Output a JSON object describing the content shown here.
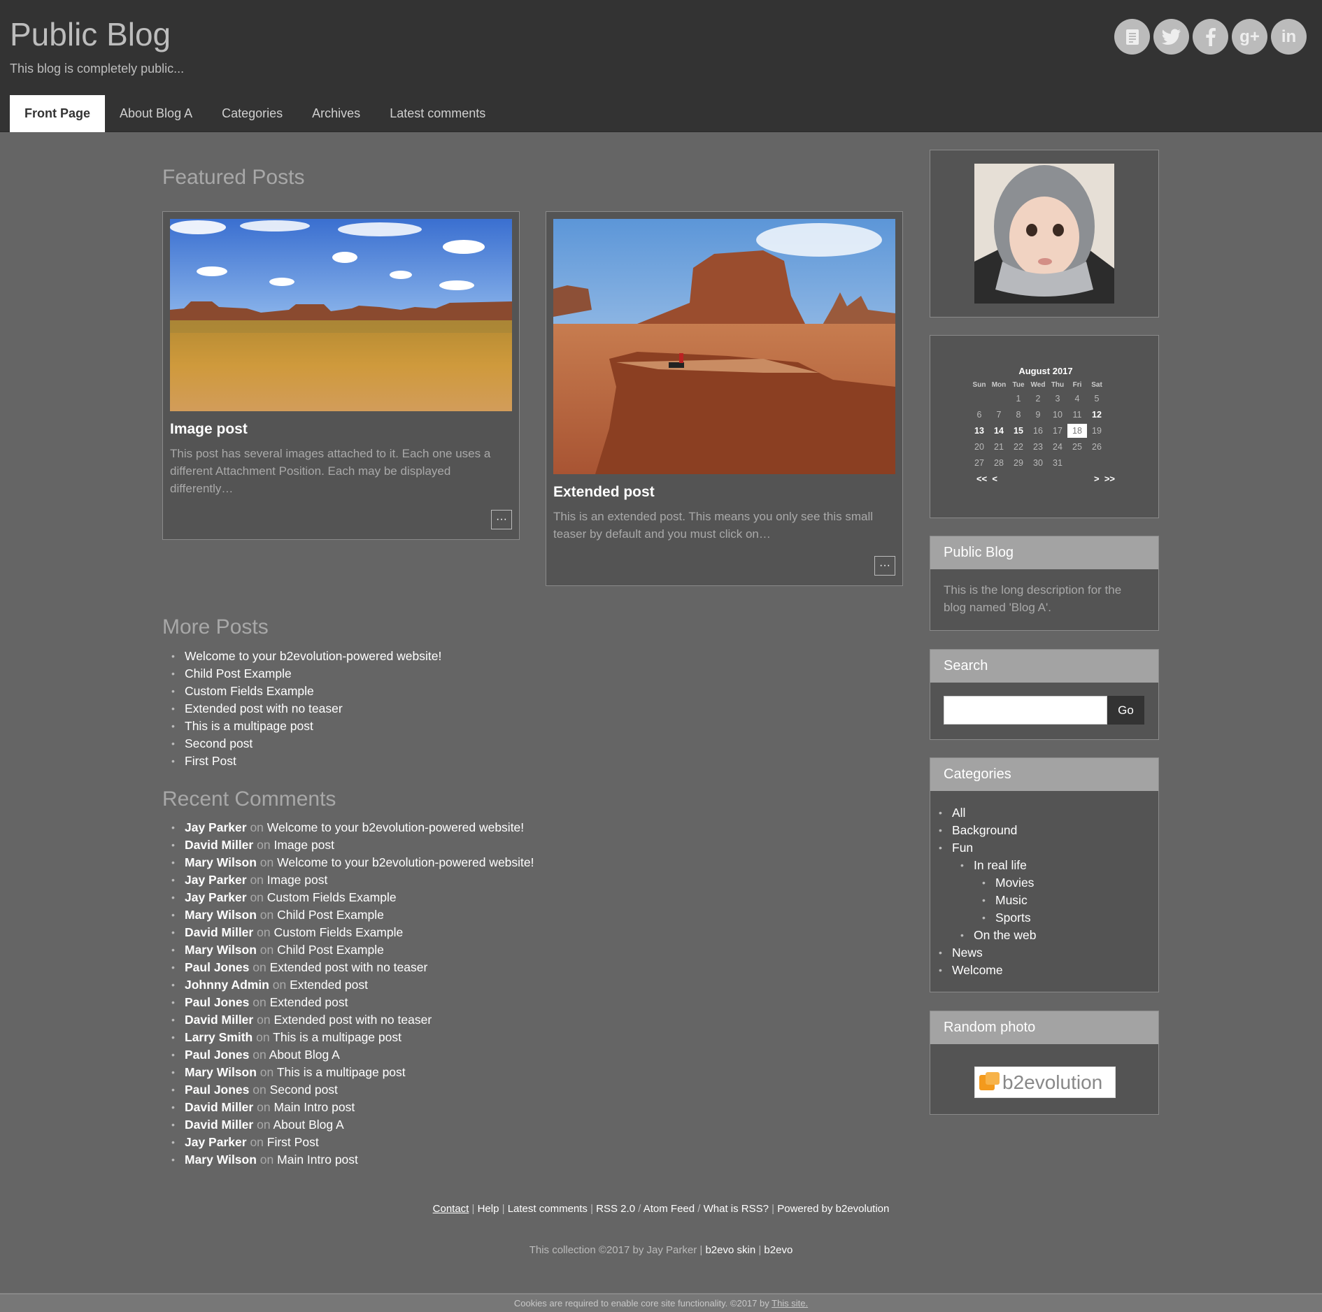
{
  "header": {
    "title": "Public Blog",
    "tagline": "This blog is completely public...",
    "social": [
      "blog-icon",
      "twitter-icon",
      "facebook-icon",
      "google-plus-icon",
      "linkedin-icon"
    ]
  },
  "nav": {
    "items": [
      "Front Page",
      "About Blog A",
      "Categories",
      "Archives",
      "Latest comments"
    ],
    "active": "Front Page"
  },
  "featured": {
    "heading": "Featured Posts",
    "posts": [
      {
        "title": "Image post",
        "excerpt": "This post has several images attached to it. Each one uses a different Attachment Position. Each may be displayed differently…",
        "more": "···"
      },
      {
        "title": "Extended post",
        "excerpt": "This is an extended post. This means you only see this small teaser by default and you must click on…",
        "more": "···"
      }
    ]
  },
  "more_posts": {
    "heading": "More Posts",
    "items": [
      "Welcome to your b2evolution-powered website!",
      "Child Post Example",
      "Custom Fields Example",
      "Extended post with no teaser",
      "This is a multipage post",
      "Second post",
      "First Post"
    ]
  },
  "recent_comments": {
    "heading": "Recent Comments",
    "on": "on",
    "items": [
      {
        "author": "Jay Parker",
        "post": "Welcome to your b2evolution-powered website!"
      },
      {
        "author": "David Miller",
        "post": "Image post"
      },
      {
        "author": "Mary Wilson",
        "post": "Welcome to your b2evolution-powered website!"
      },
      {
        "author": "Jay Parker",
        "post": "Image post"
      },
      {
        "author": "Jay Parker",
        "post": "Custom Fields Example"
      },
      {
        "author": "Mary Wilson",
        "post": "Child Post Example"
      },
      {
        "author": "David Miller",
        "post": "Custom Fields Example"
      },
      {
        "author": "Mary Wilson",
        "post": "Child Post Example"
      },
      {
        "author": "Paul Jones",
        "post": "Extended post with no teaser"
      },
      {
        "author": "Johnny Admin",
        "post": "Extended post"
      },
      {
        "author": "Paul Jones",
        "post": "Extended post"
      },
      {
        "author": "David Miller",
        "post": "Extended post with no teaser"
      },
      {
        "author": "Larry Smith",
        "post": "This is a multipage post"
      },
      {
        "author": "Paul Jones",
        "post": "About Blog A"
      },
      {
        "author": "Mary Wilson",
        "post": "This is a multipage post"
      },
      {
        "author": "Paul Jones",
        "post": "Second post"
      },
      {
        "author": "David Miller",
        "post": "Main Intro post"
      },
      {
        "author": "David Miller",
        "post": "About Blog A"
      },
      {
        "author": "Jay Parker",
        "post": "First Post"
      },
      {
        "author": "Mary Wilson",
        "post": "Main Intro post"
      }
    ]
  },
  "sidebar": {
    "calendar": {
      "caption": "August 2017",
      "day_headers": [
        "Sun",
        "Mon",
        "Tue",
        "Wed",
        "Thu",
        "Fri",
        "Sat"
      ],
      "leading_blanks": 2,
      "days": 31,
      "bold_days": [
        12,
        13,
        14,
        15
      ],
      "today": 18,
      "nav_prev": [
        "<<",
        "<"
      ],
      "nav_next": [
        ">",
        ">>"
      ]
    },
    "about": {
      "heading": "Public Blog",
      "text": "This is the long description for the blog named 'Blog A'."
    },
    "search": {
      "heading": "Search",
      "placeholder": "",
      "button": "Go"
    },
    "categories": {
      "heading": "Categories",
      "all": "All",
      "background": "Background",
      "fun": "Fun",
      "in_real_life": "In real life",
      "movies": "Movies",
      "music": "Music",
      "sports": "Sports",
      "on_the_web": "On the web",
      "news": "News",
      "welcome": "Welcome"
    },
    "random_photo": {
      "heading": "Random photo",
      "logo_text": "b2evolution"
    }
  },
  "footer": {
    "links": [
      "Contact",
      "Help",
      "Latest comments",
      "RSS 2.0",
      "Atom Feed",
      "What is RSS?",
      "Powered by b2evolution"
    ],
    "copy_prefix": "This collection ©2017 by Jay Parker",
    "copy_links": [
      "b2evo skin",
      "b2evo"
    ],
    "cookie_text": "Cookies are required to enable core site functionality. ©2017 by",
    "cookie_link": "This site."
  },
  "colors": {
    "header_bg": "#333333",
    "body_bg": "#656565",
    "widget_bg": "#545454",
    "widget_head": "#a3a3a3"
  }
}
